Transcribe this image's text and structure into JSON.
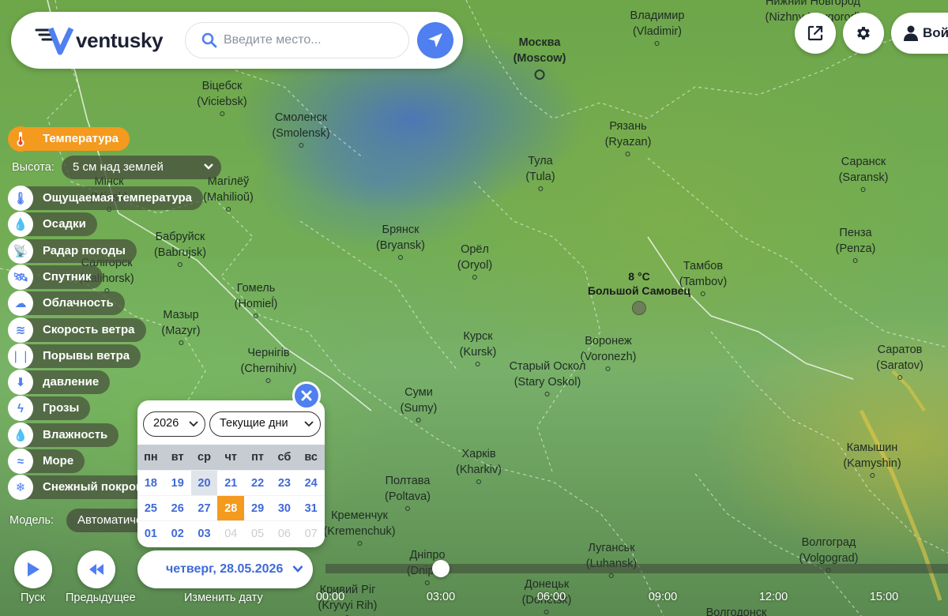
{
  "app": {
    "name": "ventusky"
  },
  "search": {
    "placeholder": "Введите место..."
  },
  "header": {
    "login_label": "Вой"
  },
  "cities": [
    {
      "name": "Москва",
      "latin": "(Moscow)",
      "bold": true,
      "capital": true
    },
    {
      "name": "Владимир",
      "latin": "(Vladimir)"
    },
    {
      "name": "Нижний Новгород",
      "latin": "(Nizhny Novgorod)"
    },
    {
      "name": "Віцебск",
      "latin": "(Viciebsk)"
    },
    {
      "name": "Смоленск",
      "latin": "(Smolensk)"
    },
    {
      "name": "Рязань",
      "latin": "(Ryazan)"
    },
    {
      "name": "Тула",
      "latin": "(Tula)"
    },
    {
      "name": "Саранск",
      "latin": "(Saransk)"
    },
    {
      "name": "Мінск",
      "latin": "(Minsk)"
    },
    {
      "name": "Магілёў",
      "latin": "(Mahilioŭ)"
    },
    {
      "name": "Брянск",
      "latin": "(Bryansk)"
    },
    {
      "name": "Пенза",
      "latin": "(Penza)"
    },
    {
      "name": "Бабруйск",
      "latin": "(Babrujsk)"
    },
    {
      "name": "Орёл",
      "latin": "(Oryol)"
    },
    {
      "name": "Тамбов",
      "latin": "(Tambov)"
    },
    {
      "name": "Салігорск",
      "latin": "(Salihorsk)"
    },
    {
      "name": "Гомель",
      "latin": "(Homieĺ)"
    },
    {
      "name": "Мазыр",
      "latin": "(Mazyr)"
    },
    {
      "name": "Курск",
      "latin": "(Kursk)"
    },
    {
      "name": "Воронеж",
      "latin": "(Voronezh)"
    },
    {
      "name": "Чернігів",
      "latin": "(Chernihiv)"
    },
    {
      "name": "Старый Оскол",
      "latin": "(Stary Oskol)"
    },
    {
      "name": "Саратов",
      "latin": "(Saratov)"
    },
    {
      "name": "Суми",
      "latin": "(Sumy)"
    },
    {
      "name": "Харків",
      "latin": "(Kharkiv)"
    },
    {
      "name": "Камышин",
      "latin": "(Kamyshin)"
    },
    {
      "name": "Полтава",
      "latin": "(Poltava)"
    },
    {
      "name": "Кременчук",
      "latin": "(Kremenchuk)"
    },
    {
      "name": "Луганськ",
      "latin": "(Luhansk)"
    },
    {
      "name": "Волгоград",
      "latin": "(Volgograd)"
    },
    {
      "name": "Дніпро",
      "latin": "(Dnipro)"
    },
    {
      "name": "Донецьк",
      "latin": "(Donetsk)"
    },
    {
      "name": "Кривий Ріг",
      "latin": "(Kryvyi Rih)"
    },
    {
      "name": "Волгодонск",
      "latin": ""
    }
  ],
  "marker": {
    "temperature": "8 °C",
    "place": "Большой Самовец"
  },
  "layers": {
    "active": "Температура",
    "height_label": "Высота:",
    "height_value": "5 см над землей",
    "items": [
      "Ощущаемая температура",
      "Осадки",
      "Радар погоды",
      "Спутник",
      "Облачность",
      "Скорость ветра",
      "Порывы ветра",
      "давление",
      "Грозы",
      "Влажность",
      "Море",
      "Снежный покров"
    ],
    "model_label": "Модель:",
    "model_value": "Автоматически"
  },
  "calendar": {
    "year": "2026",
    "range": "Текущие дни",
    "weekdays": [
      "пн",
      "вт",
      "ср",
      "чт",
      "пт",
      "сб",
      "вс"
    ],
    "weeks": [
      [
        {
          "d": "18"
        },
        {
          "d": "19"
        },
        {
          "d": "20",
          "state": "today"
        },
        {
          "d": "21"
        },
        {
          "d": "22"
        },
        {
          "d": "23"
        },
        {
          "d": "24"
        }
      ],
      [
        {
          "d": "25"
        },
        {
          "d": "26"
        },
        {
          "d": "27"
        },
        {
          "d": "28",
          "state": "sel"
        },
        {
          "d": "29"
        },
        {
          "d": "30"
        },
        {
          "d": "31"
        }
      ],
      [
        {
          "d": "01"
        },
        {
          "d": "02"
        },
        {
          "d": "03"
        },
        {
          "d": "04",
          "state": "off"
        },
        {
          "d": "05",
          "state": "off"
        },
        {
          "d": "06",
          "state": "off"
        },
        {
          "d": "07",
          "state": "off"
        }
      ]
    ]
  },
  "controls": {
    "play_label": "Пуск",
    "prev_label": "Предыдущее",
    "change_date_label": "Изменить дату",
    "current_date": "четверг, 28.05.2026"
  },
  "timeline": {
    "ticks": [
      "00:00",
      "03:00",
      "06:00",
      "09:00",
      "12:00",
      "15:00"
    ],
    "current": "03:00"
  },
  "colors": {
    "accent": "#4f7ff0",
    "active_layer": "#f39a1f",
    "date_text": "#3f6ad8"
  }
}
